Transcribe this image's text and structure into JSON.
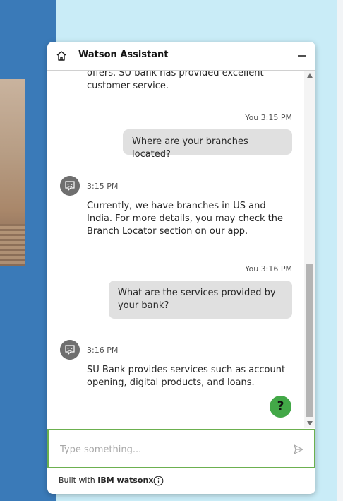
{
  "header": {
    "title": "Watson Assistant"
  },
  "messages": {
    "bot_partial": "offers. SU bank has provided excellent customer service.",
    "user_1": {
      "meta": "You 3:15 PM",
      "text": "Where are your branches located?"
    },
    "bot_1": {
      "time": "3:15 PM",
      "text": "Currently, we have branches in US and India. For more details, you may check the Branch Locator section on our app."
    },
    "user_2": {
      "meta": "You 3:16 PM",
      "text": "What are the services provided by your bank?"
    },
    "bot_2": {
      "time": "3:16 PM",
      "text": "SU Bank provides services such as account opening, digital products, and loans."
    }
  },
  "help_button": {
    "label": "?"
  },
  "composer": {
    "placeholder": "Type something..."
  },
  "footer": {
    "prefix": "Built with ",
    "brand": "IBM watsonx"
  },
  "colors": {
    "accent_green": "#42a847",
    "input_border": "#6cb04f",
    "page_blue": "#3a7ab8"
  }
}
